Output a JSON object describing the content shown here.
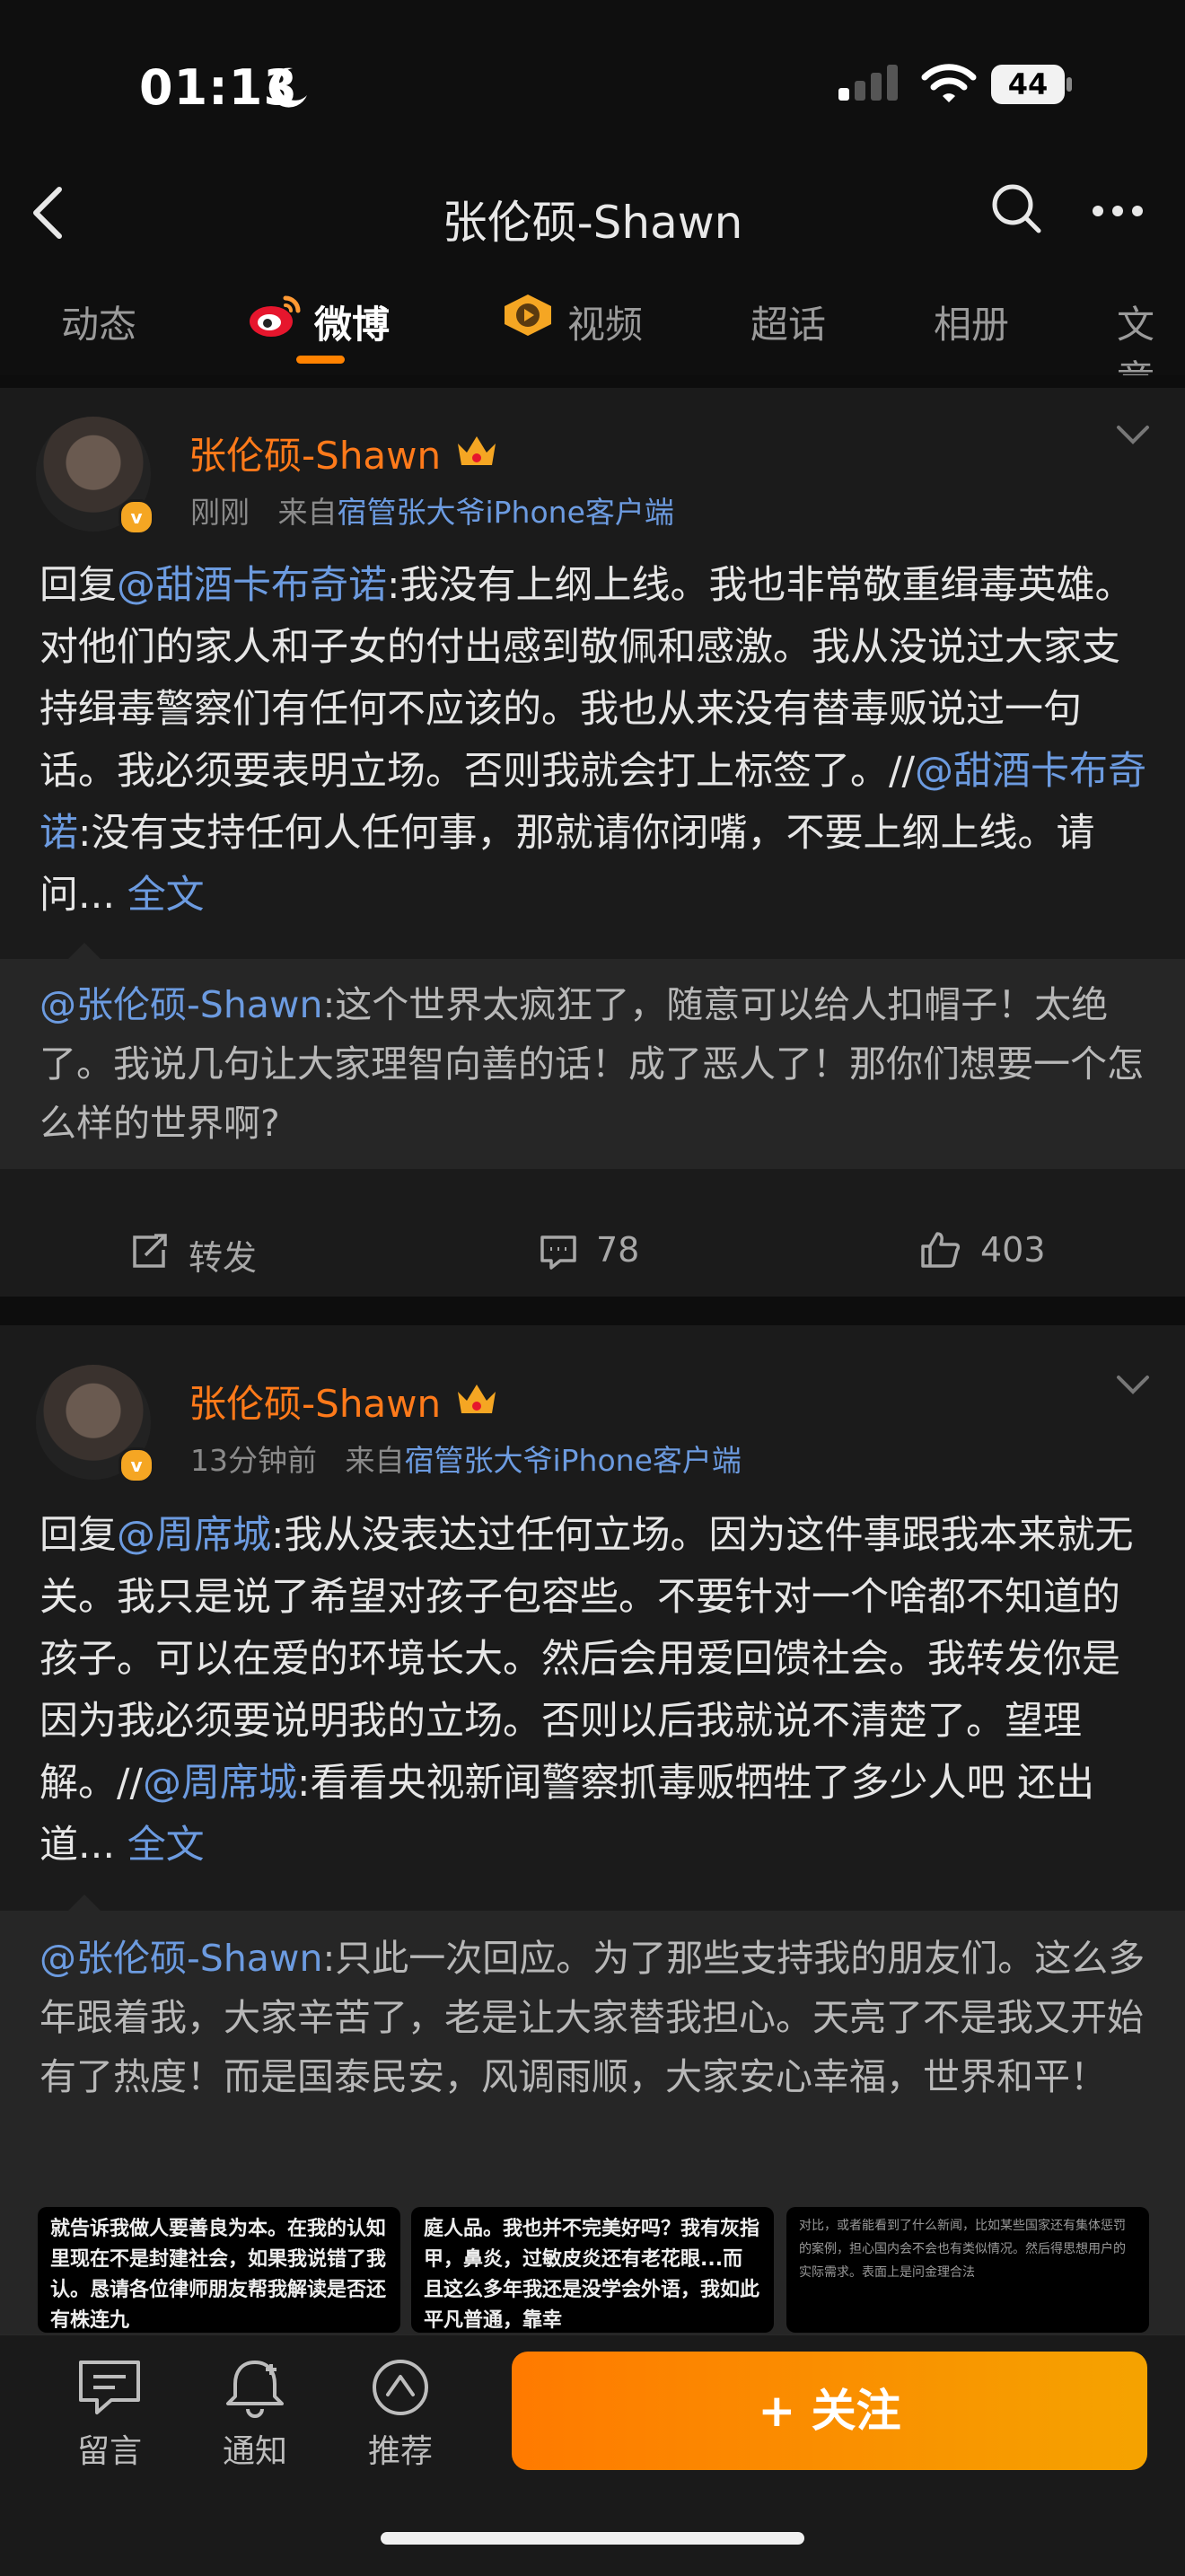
{
  "status": {
    "time": "01:13",
    "battery": "44"
  },
  "nav": {
    "title": "张伦硕-Shawn"
  },
  "tabs": [
    "动态",
    "微博",
    "视频",
    "超话",
    "相册",
    "文章"
  ],
  "posts": [
    {
      "username": "张伦硕-Shawn",
      "time": "刚刚",
      "source_prefix": "来自",
      "source": "宿管张大爷iPhone客户端",
      "reply_prefix": "回复",
      "mention1": "@甜酒卡布奇诺",
      "text1": ":我没有上纲上线。我也非常敬重缉毒英雄。对他们的家人和子女的付出感到敬佩和感激。我从没说过大家支持缉毒警察们有任何不应该的。我也从来没有替毒贩说过一句话。我必须要表明立场。否则我就会打上标签了。//",
      "mention2": "@甜酒卡布奇诺",
      "text2": ":没有支持任何人任何事，那就请你闭嘴，不要上纲上线。请问...",
      "more": "全文",
      "quote_mention": "@张伦硕-Shawn",
      "quote_text": ":这个世界太疯狂了，随意可以给人扣帽子！太绝了。我说几句让大家理智向善的话！成了恶人了！那你们想要一个怎么样的世界啊?",
      "repost_label": "转发",
      "comments": "78",
      "likes": "403"
    },
    {
      "username": "张伦硕-Shawn",
      "time": "13分钟前",
      "source_prefix": "来自",
      "source": "宿管张大爷iPhone客户端",
      "reply_prefix": "回复",
      "mention1": "@周席城",
      "text1": ":我从没表达过任何立场。因为这件事跟我本来就无关。我只是说了希望对孩子包容些。不要针对一个啥都不知道的孩子。可以在爱的环境长大。然后会用爱回馈社会。我转发你是因为我必须要说明我的立场。否则以后我就说不清楚了。望理解。//",
      "mention2": "@周席城",
      "text2": ":看看央视新闻警察抓毒贩牺牲了多少人吧 还出道...",
      "more": "全文",
      "quote_mention": "@张伦硕-Shawn",
      "quote_text": ":只此一次回应。为了那些支持我的朋友们。这么多年跟着我，大家辛苦了，老是让大家替我担心。天亮了不是我又开始有了热度！而是国泰民安，风调雨顺，大家安心幸福，世界和平！",
      "thumbs": [
        "就告诉我做人要善良为本。在我的认知里现在不是封建社会，如果我说错了我认。恳请各位律师朋友帮我解读是否还有株连九",
        "庭人品。我也并不完美好吗？我有灰指甲，鼻炎，过敏皮炎还有老花眼...而且这么多年我还是没学会外语，我如此平凡普通，靠幸",
        "对比，或者能看到了什么新闻，比如某些国家还有集体惩罚的案例，担心国内会不会也有类似情况。然后得思想用户的实际需求。表面上是问金理合法"
      ]
    }
  ],
  "bottom": {
    "comment": "留言",
    "notify": "通知",
    "recommend": "推荐",
    "follow": "+ 关注"
  },
  "colors": {
    "accent": "#ff8200",
    "username": "#ff7a1a",
    "link": "#6c9be0"
  }
}
